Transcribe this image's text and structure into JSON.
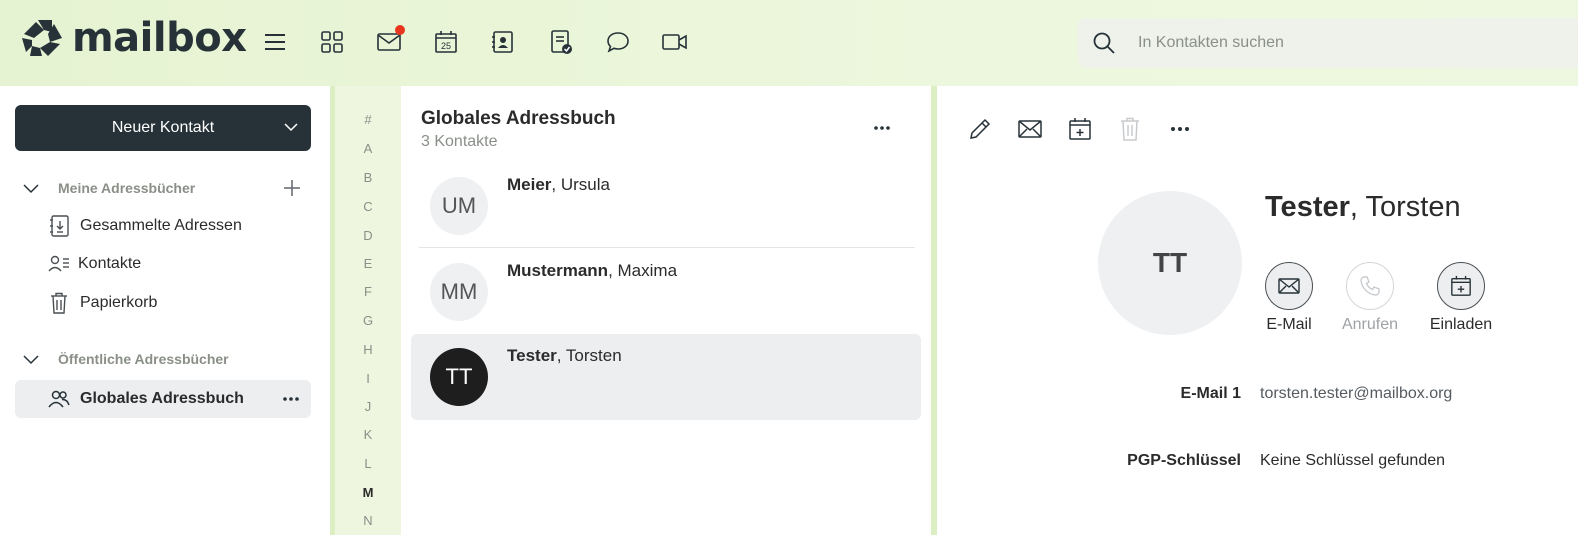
{
  "app": {
    "brand": "mailbox",
    "nav_icons": [
      "menu-icon",
      "apps-icon",
      "mail-icon",
      "calendar-icon",
      "contacts-icon",
      "tasks-icon",
      "chat-icon",
      "video-icon"
    ],
    "calendar_day": "25",
    "mail_has_unread": true,
    "accent_color": "#263238",
    "badge_color": "#e8361e"
  },
  "search": {
    "placeholder": "In Kontakten suchen"
  },
  "sidebar": {
    "new_contact_label": "Neuer Kontakt",
    "my_books_heading": "Meine Adressbücher",
    "my_books": [
      {
        "label": "Gesammelte Adressen",
        "icon": "collected-addresses-icon"
      },
      {
        "label": "Kontakte",
        "icon": "contacts-list-icon"
      },
      {
        "label": "Papierkorb",
        "icon": "trash-icon"
      }
    ],
    "public_books_heading": "Öffentliche Adressbücher",
    "public_books": [
      {
        "label": "Globales Adressbuch",
        "icon": "group-icon",
        "active": true
      }
    ]
  },
  "alphabet": [
    "#",
    "A",
    "B",
    "C",
    "D",
    "E",
    "F",
    "G",
    "H",
    "I",
    "J",
    "K",
    "L",
    "M",
    "N"
  ],
  "alphabet_active": "M",
  "list": {
    "title": "Globales Adressbuch",
    "count": "3 Kontakte",
    "contacts": [
      {
        "initials": "UM",
        "last": "Meier",
        "first": ", Ursula",
        "selected": false
      },
      {
        "initials": "MM",
        "last": "Mustermann",
        "first": ", Maxima",
        "selected": false
      },
      {
        "initials": "TT",
        "last": "Tester",
        "first": ", Torsten",
        "selected": true
      }
    ]
  },
  "detail": {
    "toolbar": [
      "edit-icon",
      "email-icon",
      "calendar-add-icon",
      "trash-icon",
      "more-icon"
    ],
    "initials": "TT",
    "last": "Tester",
    "first": ", Torsten",
    "actions": [
      {
        "label": "E-Mail",
        "icon": "email-icon",
        "enabled": true
      },
      {
        "label": "Anrufen",
        "icon": "phone-icon",
        "enabled": false
      },
      {
        "label": "Einladen",
        "icon": "calendar-add-icon",
        "enabled": true
      }
    ],
    "fields": [
      {
        "label": "E-Mail 1",
        "value": "torsten.tester@mailbox.org"
      },
      {
        "label": "PGP-Schlüssel",
        "value": "Keine Schlüssel gefunden"
      }
    ]
  }
}
